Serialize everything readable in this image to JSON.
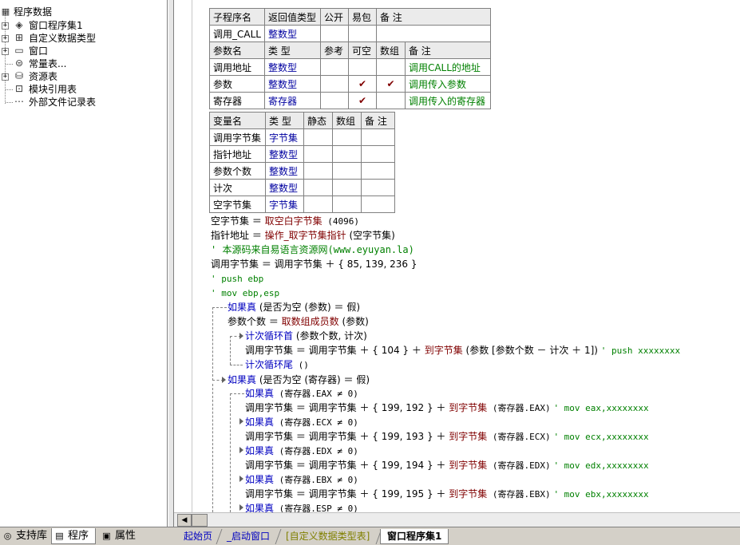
{
  "tree": {
    "root_label": "程序数据",
    "items": [
      {
        "label": "窗口程序集1",
        "icon": "stack-icon",
        "expandable": true
      },
      {
        "label": "自定义数据类型",
        "icon": "datatype-icon",
        "expandable": true
      },
      {
        "label": "窗口",
        "icon": "window-icon",
        "expandable": true
      },
      {
        "label": "常量表...",
        "icon": "constant-icon",
        "expandable": false
      },
      {
        "label": "资源表",
        "icon": "resource-icon",
        "expandable": true
      },
      {
        "label": "模块引用表",
        "icon": "module-icon",
        "expandable": false
      },
      {
        "label": "外部文件记录表",
        "icon": "file-icon",
        "expandable": false
      }
    ]
  },
  "left_tabs": [
    {
      "label": "支持库",
      "icon": "library-icon"
    },
    {
      "label": "程序",
      "icon": "program-icon",
      "active": true
    },
    {
      "label": "属性",
      "icon": "property-icon"
    }
  ],
  "sub_table": {
    "header": [
      "子程序名",
      "返回值类型",
      "公开",
      "易包",
      "备 注"
    ],
    "row": [
      "调用_CALL",
      "整数型",
      "",
      "",
      ""
    ],
    "param_header": [
      "参数名",
      "类 型",
      "参考",
      "可空",
      "数组",
      "备 注"
    ],
    "params": [
      {
        "name": "调用地址",
        "type": "整数型",
        "ref": "",
        "nullable": "",
        "array": "",
        "note": "调用CALL的地址"
      },
      {
        "name": "参数",
        "type": "整数型",
        "ref": "",
        "nullable": "✔",
        "array": "✔",
        "note": "调用传入参数"
      },
      {
        "name": "寄存器",
        "type": "寄存器",
        "ref": "",
        "nullable": "✔",
        "array": "",
        "note": "调用传入的寄存器"
      }
    ]
  },
  "var_table": {
    "header": [
      "变量名",
      "类 型",
      "静态",
      "数组",
      "备 注"
    ],
    "rows": [
      {
        "name": "调用字节集",
        "type": "字节集"
      },
      {
        "name": "指针地址",
        "type": "整数型"
      },
      {
        "name": "参数个数",
        "type": "整数型"
      },
      {
        "name": "计次",
        "type": "整数型"
      },
      {
        "name": "空字节集",
        "type": "字节集"
      }
    ]
  },
  "code": {
    "l1_a": "空字节集 ＝ ",
    "l1_fn": "取空白字节集",
    "l1_b": " (4096)",
    "l2_a": "指针地址 ＝ ",
    "l2_fn": "操作_取字节集指针",
    "l2_b": " (空字节集)",
    "l3": "' 本源码来自易语言资源网(www.eyuyan.la)",
    "l4": "调用字节集 ＝ 调用字节集 ＋ { 85, 139, 236 }",
    "l5": "' push ebp",
    "l6": "' mov ebp,esp",
    "l7_kw": "如果真",
    "l7_b": " (是否为空 (参数) ＝ 假)",
    "l8_a": "参数个数 ＝ ",
    "l8_fn": "取数组成员数",
    "l8_b": " (参数)",
    "l9_kw": "计次循环首",
    "l9_b": " (参数个数, 计次)",
    "l10_a": "调用字节集 ＝ 调用字节集 ＋ { 104 } ＋ ",
    "l10_fn": "到字节集",
    "l10_b": " (参数 [参数个数 － 计次 ＋ 1])",
    "l10_cm": "' push xxxxxxxx",
    "l11_kw": "计次循环尾",
    "l11_b": " ()",
    "l12_kw": "如果真",
    "l12_b": " (是否为空 (寄存器) ＝ 假)",
    "blocks": [
      {
        "cond": " (寄存器.EAX ≠ 0)",
        "bytes": "调用字节集 ＝ 调用字节集 ＋ { 199, 192 } ＋ ",
        "arg": " (寄存器.EAX)",
        "cm": "' mov eax,xxxxxxxx"
      },
      {
        "cond": " (寄存器.ECX ≠ 0)",
        "bytes": "调用字节集 ＝ 调用字节集 ＋ { 199, 193 } ＋ ",
        "arg": " (寄存器.ECX)",
        "cm": "' mov ecx,xxxxxxxx"
      },
      {
        "cond": " (寄存器.EDX ≠ 0)",
        "bytes": "调用字节集 ＝ 调用字节集 ＋ { 199, 194 } ＋ ",
        "arg": " (寄存器.EDX)",
        "cm": "' mov edx,xxxxxxxx"
      },
      {
        "cond": " (寄存器.EBX ≠ 0)",
        "bytes": "调用字节集 ＝ 调用字节集 ＋ { 199, 195 } ＋ ",
        "arg": " (寄存器.EBX)",
        "cm": "' mov ebx,xxxxxxxx"
      },
      {
        "cond": " (寄存器.ESP ≠ 0)"
      }
    ],
    "if_kw": "如果真",
    "tobytes": "到字节集"
  },
  "doc_tabs": [
    {
      "label": "起始页",
      "style": "blue"
    },
    {
      "label": "_启动窗口",
      "style": "blue"
    },
    {
      "label": "[自定义数据类型表]",
      "style": "olive"
    },
    {
      "label": "窗口程序集1",
      "style": "active"
    }
  ]
}
